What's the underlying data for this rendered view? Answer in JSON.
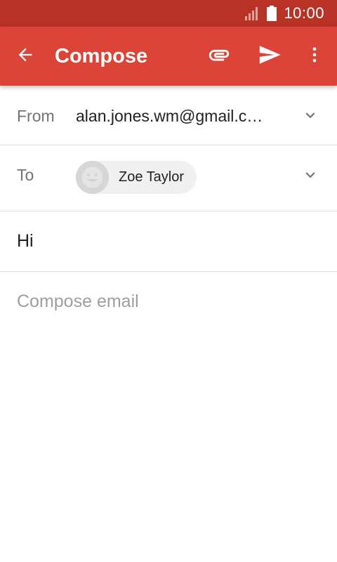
{
  "status_bar": {
    "time": "10:00",
    "icons": [
      "signal-icon",
      "battery-icon"
    ]
  },
  "app_bar": {
    "title": "Compose",
    "color": "#db4437",
    "icons": [
      "back-arrow-icon",
      "paperclip-icon",
      "send-icon",
      "more-vert-icon"
    ]
  },
  "compose": {
    "from_label": "From",
    "from_value": "alan.jones.wm@gmail.c…",
    "to_label": "To",
    "recipients": [
      {
        "name": "Zoe Taylor",
        "avatar": "avatar-placeholder-icon"
      }
    ],
    "subject": "Hi",
    "body_placeholder": "Compose email"
  },
  "colors": {
    "status_bar": "#b83325",
    "accent": "#db4437",
    "label_text": "#737373",
    "placeholder_text": "#9e9e9e"
  }
}
